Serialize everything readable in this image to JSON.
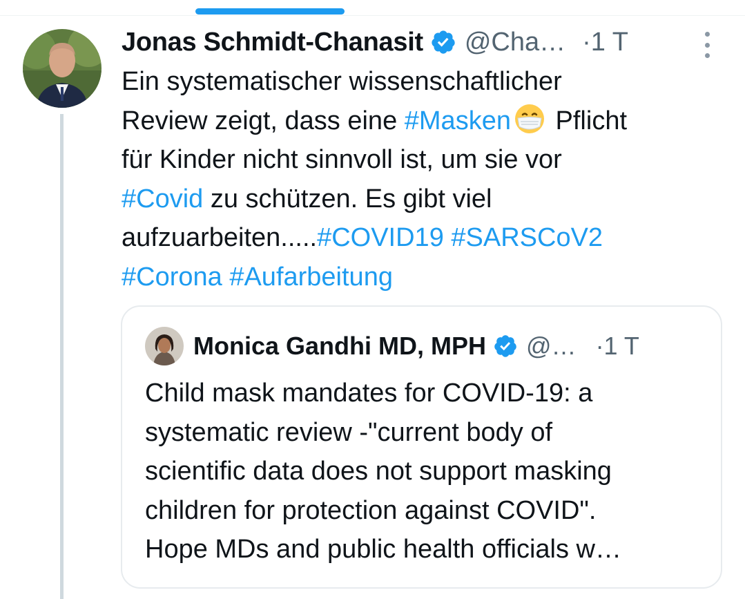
{
  "tweet": {
    "author_name": "Jonas Schmidt-Chanasit",
    "handle": "@Cha…",
    "time": "·1 T",
    "text_lines": [
      [
        {
          "t": "Ein systematischer wissenschaftlicher",
          "tag": false
        }
      ],
      [
        {
          "t": "Review zeigt, dass eine ",
          "tag": false
        },
        {
          "t": "#Masken",
          "tag": true
        },
        {
          "t": "EMOJI",
          "tag": false
        },
        {
          "t": " Pflicht",
          "tag": false
        }
      ],
      [
        {
          "t": "für Kinder nicht sinnvoll ist, um sie vor",
          "tag": false
        }
      ],
      [
        {
          "t": "#Covid",
          "tag": true
        },
        {
          "t": " zu schützen. Es gibt viel",
          "tag": false
        }
      ],
      [
        {
          "t": "aufzuarbeiten.....",
          "tag": false
        },
        {
          "t": "#COVID19",
          "tag": true
        },
        {
          "t": " ",
          "tag": false
        },
        {
          "t": "#SARSCoV2",
          "tag": true
        }
      ],
      [
        {
          "t": "#Corona",
          "tag": true
        },
        {
          "t": " ",
          "tag": false
        },
        {
          "t": "#Aufarbeitung",
          "tag": true
        }
      ]
    ],
    "emoji": "face-with-medical-mask-icon"
  },
  "quoted": {
    "author_name": "Monica Gandhi MD, MPH",
    "handle": "@…",
    "time": "·1 T",
    "text_lines": [
      "Child mask mandates for COVID-19: a",
      "systematic review  -\"current body of",
      "scientific data does not support masking",
      "children for protection against COVID\".",
      "Hope MDs and public  health officials w…"
    ]
  },
  "colors": {
    "accent": "#1d9bf0",
    "text": "#0f1419",
    "secondary": "#536471",
    "thread_line": "#cfd9de",
    "border": "#e7ebee"
  },
  "icons": {
    "verified": "verified-badge-icon",
    "more": "more-vertical-icon"
  }
}
